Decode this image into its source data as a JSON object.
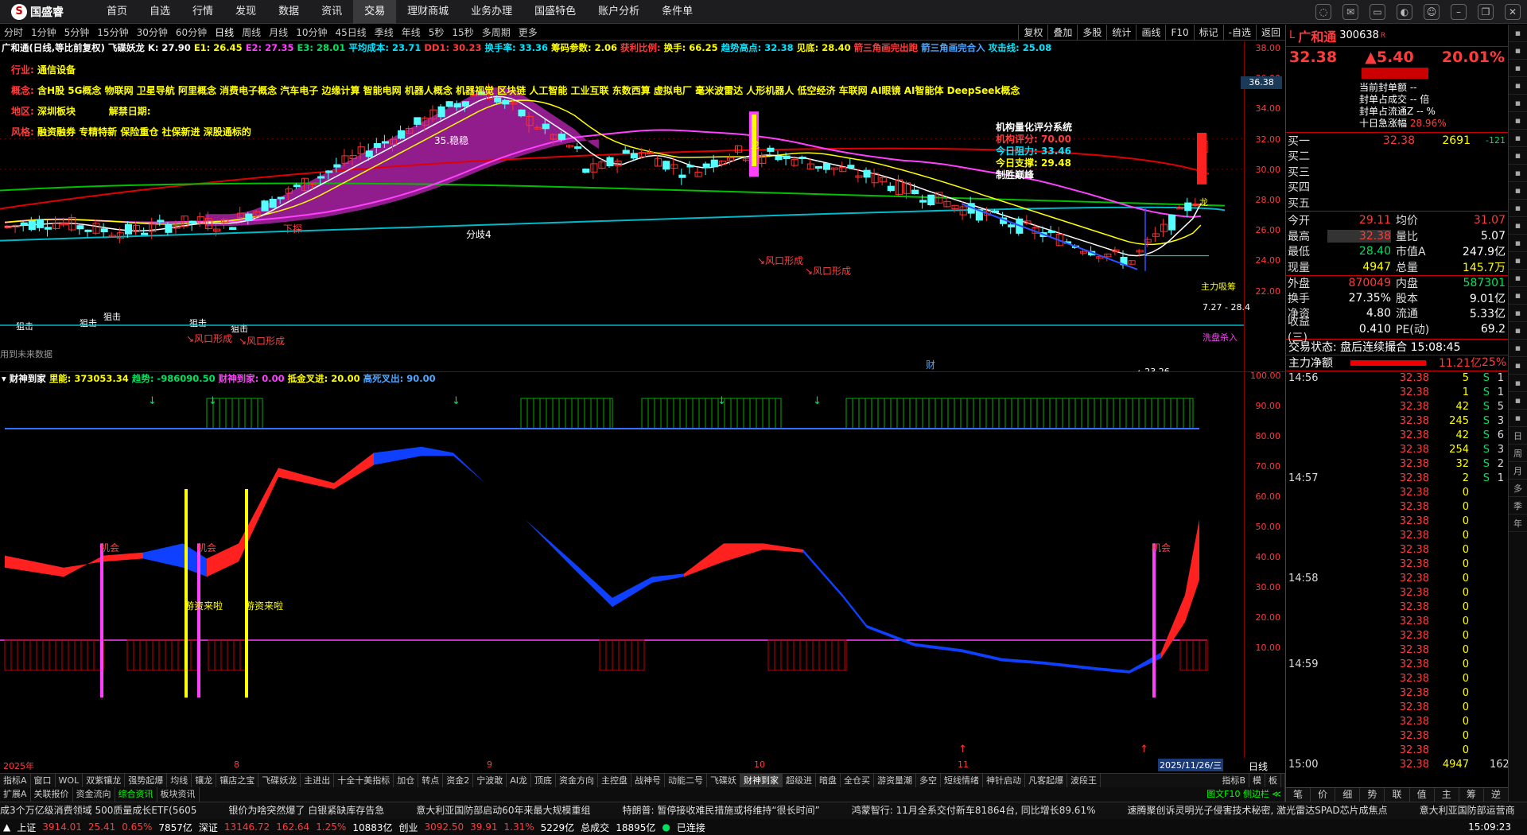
{
  "app": {
    "logo": "国盛睿",
    "logo_mark": "S"
  },
  "menu": [
    "首页",
    "自选",
    "行情",
    "发现",
    "数据",
    "资讯",
    "交易",
    "理财商城",
    "业务办理",
    "国盛特色",
    "账户分析",
    "条件单"
  ],
  "menu_active": "交易",
  "window_controls": [
    "minimize-icon",
    "restore-icon",
    "close-icon"
  ],
  "periods": [
    "分时",
    "1分钟",
    "5分钟",
    "15分钟",
    "30分钟",
    "60分钟",
    "日线",
    "周线",
    "月线",
    "10分钟",
    "45日线",
    "季线",
    "年线",
    "5秒",
    "15秒",
    "多周期",
    "更多"
  ],
  "period_active": "日线",
  "toolbar_right": [
    "复权",
    "叠加",
    "多股",
    "统计",
    "画线",
    "F10",
    "标记",
    "-自选",
    "返回"
  ],
  "main_header": {
    "name": "广和通(日线,等比前复权)",
    "indicator": "飞碟妖龙",
    "k": "K: 27.90",
    "e1": "E1: 26.45",
    "e2": "E2: 27.35",
    "e3": "E3: 28.01",
    "avg": "平均成本: 23.71",
    "dd1": "DD1: 30.23",
    "turnover": "换手率: 33.36",
    "chips": "筹码参数: 2.06",
    "profit": "获利比例: ",
    "hs": "换手: 66.25",
    "trend": "趋势高点: 32.38",
    "low": "见底: 28.40",
    "tri": "箭三角画完出跑",
    "tri2": "箭三角画完合入",
    "atk": "攻击线: 25.08"
  },
  "info": {
    "industry_label": "行业:",
    "industry": "通信设备",
    "concept_label": "概念:",
    "concepts": "含H股 5G概念 物联网 卫星导航 阿里概念 消费电子概念 汽车电子 边缘计算 智能电网 机器人概念 机器视觉 区块链 人工智能 工业互联 东数西算 虚拟电厂 毫米波雷达 人形机器人 低空经济 车联网 AI眼镜 AI智能体 DeepSeek概念",
    "area_label": "地区:",
    "area": "深圳板块",
    "alert": "解禁日期:",
    "style_label": "风格:",
    "style": "融资融券 专精特新 保险重仓 社保新进 深股通标的"
  },
  "score_box": {
    "title": "机构量化评分系统",
    "score_label": "机构评分:",
    "score": "70.00",
    "resist_label": "今日阻力:",
    "resist": "33.46",
    "support_label": "今日支撑:",
    "support": "29.48",
    "verdict": "制胜巅峰"
  },
  "chart_labels": {
    "xiajie": "下探",
    "fenkou": "分歧4",
    "fengkou": "↘风口形成",
    "zhuli": "主力吸筹",
    "xipan": "洗盘杀入",
    "peak_label": "35.稳稳",
    "range": "7.27 - 28.4",
    "low_mark": "←23.26",
    "future": "用到未来数据",
    "cai": "财",
    "dragon": "龙",
    "jidi": "狙击"
  },
  "price_axis": [
    "38.00",
    "36.00",
    "34.00",
    "32.00",
    "30.00",
    "28.00",
    "26.00",
    "24.00",
    "22.00"
  ],
  "price_current": "36.38",
  "sub_header": {
    "name": "财神到家",
    "l1": "里能: 373053.34",
    "l2": "趋势: -986090.50",
    "l3": "财神到家: 0.00",
    "l4": "抵金叉进: 20.00",
    "l5": "高死叉出: 90.00"
  },
  "sub_axis": [
    "100.00",
    "90.00",
    "80.00",
    "70.00",
    "60.00",
    "50.00",
    "40.00",
    "30.00",
    "20.00",
    "10.00"
  ],
  "sub_labels": {
    "jihui": "机会",
    "youzi": "游资来啦"
  },
  "dates": {
    "y": "2025年",
    "m8": "8",
    "m9": "9",
    "m10": "10",
    "m11": "11",
    "cur": "2025/11/26/三",
    "period": "日线"
  },
  "tabs1": [
    "指标A",
    "窗口",
    "WOL",
    "双紫镶龙",
    "强势起爆",
    "均线",
    "镶龙",
    "镶店之宝",
    "飞碟妖龙",
    "主进出",
    "十全十美指标",
    "加仓",
    "转点",
    "资金2",
    "宁波敢",
    "AI龙",
    "顶底",
    "资金方向",
    "主控盘",
    "战神号",
    "动能二号",
    "飞碟妖",
    "财神到家",
    "超级进",
    "暗盘",
    "全仓买",
    "游资量潮",
    "多空",
    "短线情绪",
    "神针启动",
    "凡客起爆",
    "波段王"
  ],
  "tabs1_active": "财神到家",
  "tabs1_right": [
    "指标B",
    "模",
    "板"
  ],
  "tabs2": [
    "扩展A",
    "关联报价",
    "资金流向",
    "综合资讯",
    "板块资讯"
  ],
  "tabs2_active": "综合资讯",
  "tabs2_right": "图文F10 侧边栏 ≪",
  "stock": {
    "name": "广和通",
    "code": "300638",
    "tag": "R",
    "price": "32.38",
    "chg": "▲5.40",
    "pct": "20.01%"
  },
  "seal": {
    "l1": "当前封单额",
    "l1v": "--",
    "l2": "封单占成交",
    "l2v": "-- 倍",
    "l3": "封单占流通Z",
    "l3v": "-- %",
    "l4": "十日急涨幅",
    "l4v": "28.96%"
  },
  "orderbook": [
    {
      "l": "买一",
      "p": "32.38",
      "v": "2691",
      "c": "-121"
    },
    {
      "l": "买二",
      "p": "",
      "v": "",
      "c": ""
    },
    {
      "l": "买三",
      "p": "",
      "v": "",
      "c": ""
    },
    {
      "l": "买四",
      "p": "",
      "v": "",
      "c": ""
    },
    {
      "l": "买五",
      "p": "",
      "v": "",
      "c": ""
    }
  ],
  "quote": [
    [
      "今开",
      "29.11",
      "均价",
      "31.07"
    ],
    [
      "最高",
      "32.38",
      "量比",
      "5.07"
    ],
    [
      "最低",
      "28.40",
      "市值A",
      "247.9亿"
    ],
    [
      "现量",
      "4947",
      "总量",
      "145.7万"
    ],
    [
      "外盘",
      "870049",
      "内盘",
      "587301"
    ],
    [
      "换手",
      "27.35%",
      "股本",
      "9.01亿"
    ],
    [
      "净资",
      "4.80",
      "流通",
      "5.33亿"
    ],
    [
      "收益(三)",
      "0.410",
      "PE(动)",
      "69.2"
    ]
  ],
  "trade_state": "交易状态: 盘后连续撮合 15:08:45",
  "net": {
    "label": "主力净额",
    "v": "11.21亿",
    "pct": "25%"
  },
  "trades": [
    [
      "14:56",
      "32.38",
      "5",
      "S",
      "1"
    ],
    [
      "",
      "32.38",
      "1",
      "S",
      "1"
    ],
    [
      "",
      "32.38",
      "42",
      "S",
      "5"
    ],
    [
      "",
      "32.38",
      "245",
      "S",
      "3"
    ],
    [
      "",
      "32.38",
      "42",
      "S",
      "6"
    ],
    [
      "",
      "32.38",
      "254",
      "S",
      "3"
    ],
    [
      "",
      "32.38",
      "32",
      "S",
      "2"
    ],
    [
      "14:57",
      "32.38",
      "2",
      "S",
      "1"
    ],
    [
      "",
      "32.38",
      "0",
      "",
      ""
    ],
    [
      "",
      "32.38",
      "0",
      "",
      ""
    ],
    [
      "",
      "32.38",
      "0",
      "",
      ""
    ],
    [
      "",
      "32.38",
      "0",
      "",
      ""
    ],
    [
      "",
      "32.38",
      "0",
      "",
      ""
    ],
    [
      "",
      "32.38",
      "0",
      "",
      ""
    ],
    [
      "14:58",
      "32.38",
      "0",
      "",
      ""
    ],
    [
      "",
      "32.38",
      "0",
      "",
      ""
    ],
    [
      "",
      "32.38",
      "0",
      "",
      ""
    ],
    [
      "",
      "32.38",
      "0",
      "",
      ""
    ],
    [
      "",
      "32.38",
      "0",
      "",
      ""
    ],
    [
      "",
      "32.38",
      "0",
      "",
      ""
    ],
    [
      "14:59",
      "32.38",
      "0",
      "",
      ""
    ],
    [
      "",
      "32.38",
      "0",
      "",
      ""
    ],
    [
      "",
      "32.38",
      "0",
      "",
      ""
    ],
    [
      "",
      "32.38",
      "0",
      "",
      ""
    ],
    [
      "",
      "32.38",
      "0",
      "",
      ""
    ],
    [
      "",
      "32.38",
      "0",
      "",
      ""
    ],
    [
      "",
      "32.38",
      "0",
      "",
      ""
    ],
    [
      "15:00",
      "32.38",
      "4947",
      "",
      "162"
    ]
  ],
  "rp_tabs": [
    "笔",
    "价",
    "细",
    "势",
    "联",
    "值",
    "主",
    "筹",
    "逆"
  ],
  "side": [
    "日",
    "周",
    "月",
    "多",
    "季",
    "年"
  ],
  "ticker": [
    "成3个万亿级消费领域 500质量成长ETF(5605",
    "银价为啥突然爆了 白银紧缺库存告急",
    "意大利亚国防部启动60年来最大规模重组",
    "特朗普: 暂停接收难民措施或将维持“很长时间”",
    "鸿蒙智行: 11月全系交付新车81864台, 同比增长89.61%",
    "速腾聚创诉灵明光子侵害技术秘密, 激光雷达SPAD芯片成焦点",
    "意大利亚国防部运营商"
  ],
  "status": {
    "sh": "上证",
    "sh_v": "3914.01",
    "sh_c": "25.41",
    "sh_p": "0.65%",
    "sh_a": "7857亿",
    "sz": "深证",
    "sz_v": "13146.72",
    "sz_c": "162.64",
    "sz_p": "1.25%",
    "sz_a": "10883亿",
    "cy": "创业",
    "cy_v": "3092.50",
    "cy_c": "39.91",
    "cy_p": "1.31%",
    "cy_a": "5229亿",
    "total": "总成交",
    "total_v": "18895亿",
    "conn": "已连接",
    "time": "15:09:23"
  }
}
